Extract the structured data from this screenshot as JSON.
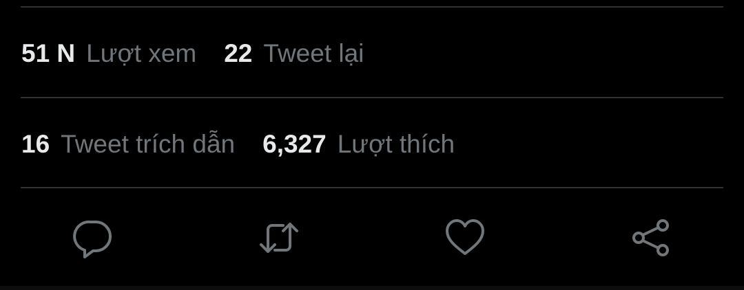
{
  "stats": {
    "views": {
      "count": "51 N",
      "label": "Lượt xem"
    },
    "retweets": {
      "count": "22",
      "label": "Tweet lại"
    },
    "quote_tweets": {
      "count": "16",
      "label": "Tweet trích dẫn"
    },
    "likes": {
      "count": "6,327",
      "label": "Lượt thích"
    }
  },
  "actions": [
    {
      "icon": "reply-icon"
    },
    {
      "icon": "retweet-icon"
    },
    {
      "icon": "like-icon"
    },
    {
      "icon": "share-icon"
    }
  ],
  "colors": {
    "background": "#000000",
    "primary_text": "#e7e9ea",
    "secondary_text": "#71767b",
    "divider": "#2f3336"
  }
}
